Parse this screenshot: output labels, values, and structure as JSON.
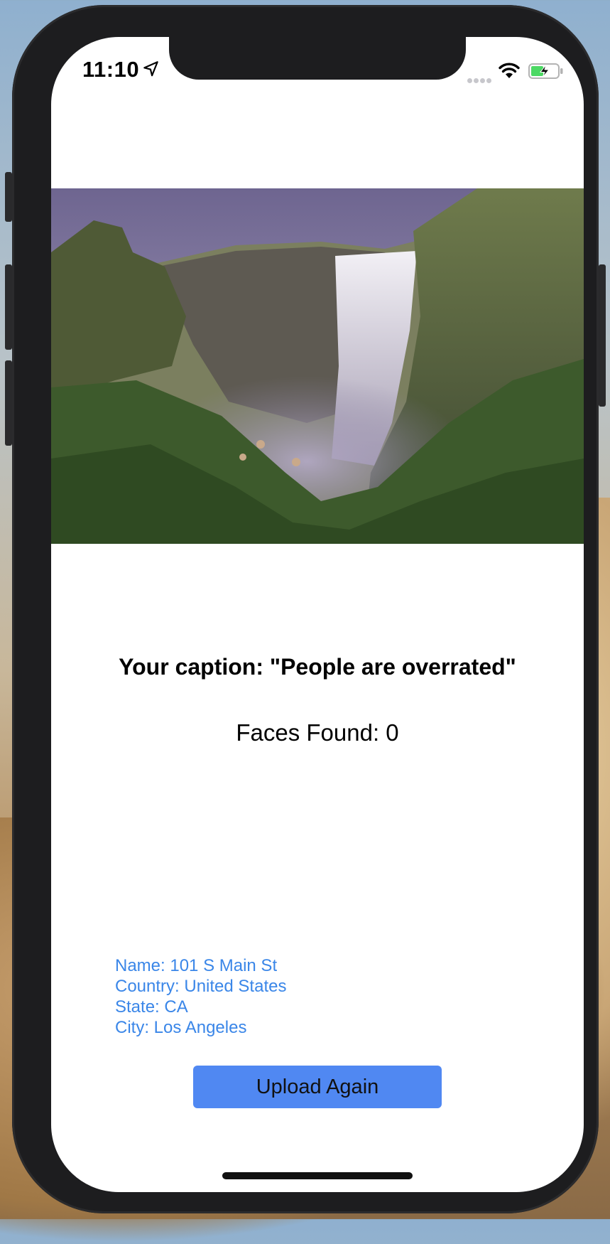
{
  "status_bar": {
    "time": "11:10"
  },
  "icons": {
    "location": "location-arrow-icon",
    "wifi": "wifi-icon",
    "battery": "battery-charging-icon",
    "signal": "signal-dots-icon"
  },
  "photo": {
    "subject": "waterfall-landscape"
  },
  "result": {
    "caption": "Your caption: \"People are overrated\"",
    "faces": "Faces Found: 0"
  },
  "location": {
    "name": "Name: 101 S Main St",
    "country": "Country: United States",
    "state": "State: CA",
    "city": "City: Los Angeles"
  },
  "actions": {
    "upload_again": "Upload Again"
  },
  "colors": {
    "accent_button": "#5088f2",
    "location_text": "#3a86e8",
    "battery_fill": "#4cd964"
  }
}
